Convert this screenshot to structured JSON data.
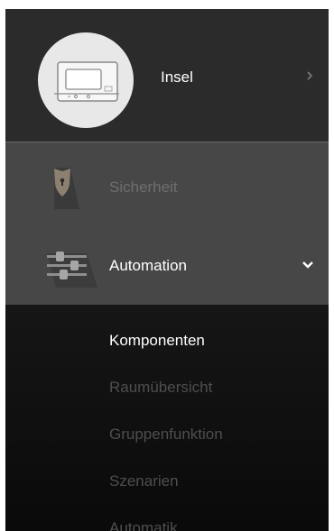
{
  "device": {
    "name": "Insel",
    "icon": "control-panel-device-icon",
    "chevron_icon": "chevron-right-icon"
  },
  "menu": {
    "items": [
      {
        "label": "Sicherheit",
        "icon": "shield-keyhole-icon",
        "enabled": false
      },
      {
        "label": "Automation",
        "icon": "sliders-icon",
        "expanded": true,
        "chevron_icon": "chevron-down-icon"
      }
    ]
  },
  "submenu": {
    "items": [
      {
        "label": "Komponenten",
        "active": true
      },
      {
        "label": "Raumübersicht",
        "active": false
      },
      {
        "label": "Gruppenfunktion",
        "active": false
      },
      {
        "label": "Szenarien",
        "active": false
      },
      {
        "label": "Automatik",
        "active": false
      }
    ]
  },
  "colors": {
    "header_bg": "#2b2b2b",
    "menu_bg": "#474747",
    "submenu_bg": "#0e0e0e",
    "text_active": "#ffffff",
    "text_disabled": "#6e6e6e",
    "text_inactive": "#4e4e4e",
    "shield": "#8c8170"
  }
}
